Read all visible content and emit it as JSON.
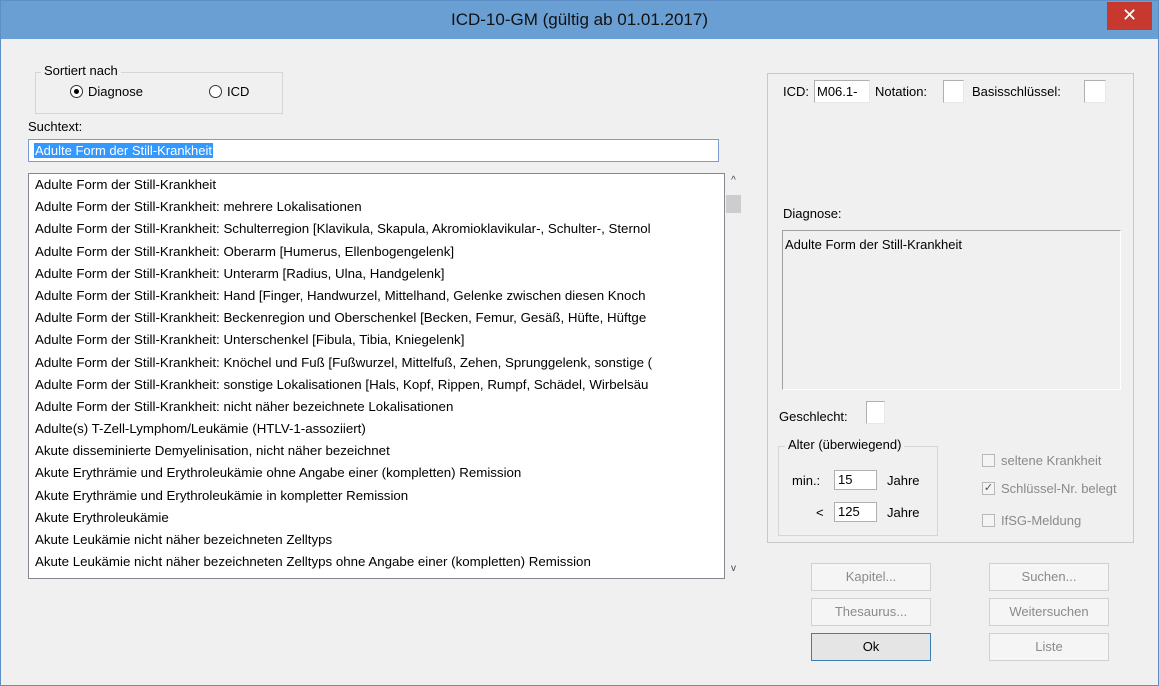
{
  "window": {
    "title": "ICD-10-GM (gültig ab 01.01.2017)",
    "close_glyph": "✕"
  },
  "sort": {
    "legend": "Sortiert nach",
    "options": [
      {
        "label": "Diagnose",
        "selected": true
      },
      {
        "label": "ICD",
        "selected": false
      }
    ]
  },
  "search": {
    "label": "Suchtext:",
    "value": "Adulte Form der Still-Krankheit"
  },
  "list": {
    "items": [
      "Adulte Form der Still-Krankheit",
      "Adulte Form der Still-Krankheit: mehrere Lokalisationen",
      "Adulte Form der Still-Krankheit: Schulterregion [Klavikula, Skapula, Akromioklavikular-, Schulter-, Sternol",
      "Adulte Form der Still-Krankheit: Oberarm [Humerus, Ellenbogengelenk]",
      "Adulte Form der Still-Krankheit: Unterarm [Radius, Ulna, Handgelenk]",
      "Adulte Form der Still-Krankheit: Hand [Finger, Handwurzel, Mittelhand, Gelenke zwischen diesen Knoch",
      "Adulte Form der Still-Krankheit: Beckenregion und Oberschenkel [Becken, Femur, Gesäß, Hüfte, Hüftge",
      "Adulte Form der Still-Krankheit: Unterschenkel [Fibula, Tibia, Kniegelenk]",
      "Adulte Form der Still-Krankheit: Knöchel und Fuß [Fußwurzel, Mittelfuß, Zehen, Sprunggelenk, sonstige (",
      "Adulte Form der Still-Krankheit: sonstige Lokalisationen [Hals, Kopf, Rippen, Rumpf, Schädel, Wirbelsäu",
      "Adulte Form der Still-Krankheit: nicht näher bezeichnete Lokalisationen",
      "Adulte(s) T-Zell-Lymphom/Leukämie (HTLV-1-assoziiert)",
      "Akute disseminierte Demyelinisation, nicht näher bezeichnet",
      "Akute Erythrämie und Erythroleukämie ohne Angabe einer (kompletten) Remission",
      "Akute Erythrämie und Erythroleukämie in kompletter Remission",
      "Akute Erythroleukämie",
      "Akute Leukämie nicht näher bezeichneten Zelltyps",
      "Akute Leukämie nicht näher bezeichneten Zelltyps ohne Angabe einer (kompletten) Remission"
    ],
    "scroll_up_glyph": "^",
    "scroll_down_glyph": "v"
  },
  "details": {
    "icd_label": "ICD:",
    "icd_value": "M06.1-",
    "notation_label": "Notation:",
    "notation_value": "",
    "basis_label": "Basisschlüssel:",
    "basis_value": "",
    "diagnose_label": "Diagnose:",
    "diagnose_value": "Adulte Form der Still-Krankheit",
    "geschlecht_label": "Geschlecht:",
    "geschlecht_value": ""
  },
  "age": {
    "legend": "Alter (überwiegend)",
    "min_label": "min.:",
    "min_value": "15",
    "max_label": "<",
    "max_value": "125",
    "unit": "Jahre"
  },
  "flags": [
    {
      "label": "seltene Krankheit",
      "checked": false
    },
    {
      "label": "Schlüssel-Nr. belegt",
      "checked": true
    },
    {
      "label": "IfSG-Meldung",
      "checked": false
    }
  ],
  "buttons": {
    "kapitel": "Kapitel...",
    "suchen": "Suchen...",
    "thesaurus": "Thesaurus...",
    "weitersuchen": "Weitersuchen",
    "ok": "Ok",
    "liste": "Liste"
  }
}
